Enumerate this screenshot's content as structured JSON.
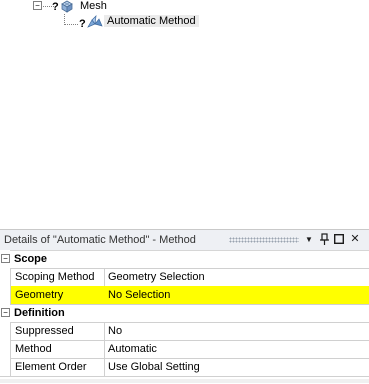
{
  "tree": {
    "expander_symbol": "−",
    "nodes": [
      {
        "label": "Mesh",
        "status": "?",
        "icon": "mesh-icon"
      },
      {
        "label": "Automatic Method",
        "status": "?",
        "icon": "method-icon"
      }
    ]
  },
  "details": {
    "title": "Details of \"Automatic Method\" - Method",
    "buttons": {
      "dropdown": "▼",
      "pin": "⊥",
      "maximize": "□",
      "close": "✕"
    },
    "collapse_symbol": "−",
    "sections": [
      {
        "title": "Scope",
        "rows": [
          {
            "name": "Scoping Method",
            "value": "Geometry Selection",
            "highlight": false
          },
          {
            "name": "Geometry",
            "value": "No Selection",
            "highlight": true
          }
        ]
      },
      {
        "title": "Definition",
        "rows": [
          {
            "name": "Suppressed",
            "value": "No",
            "highlight": false
          },
          {
            "name": "Method",
            "value": "Automatic",
            "highlight": false
          },
          {
            "name": "Element Order",
            "value": "Use Global Setting",
            "highlight": false
          }
        ]
      }
    ],
    "highlight_color": "#ffff00"
  }
}
